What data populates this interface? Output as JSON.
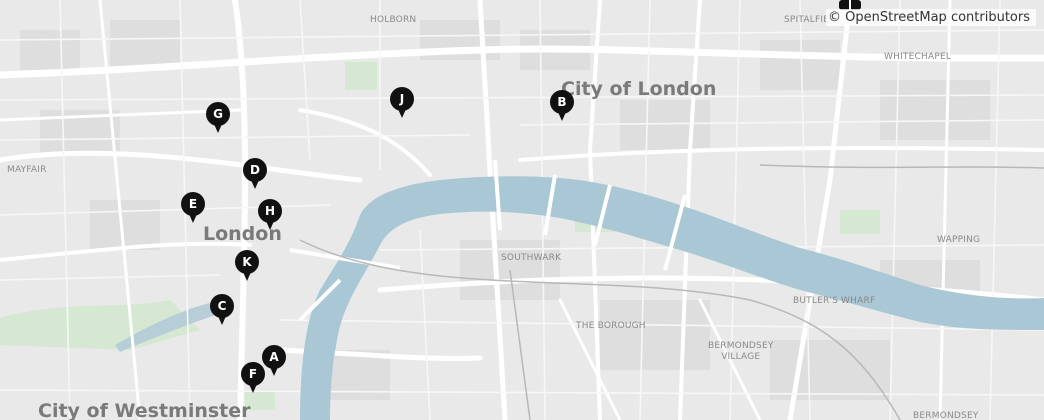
{
  "attribution": "© OpenStreetMap contributors",
  "place_labels": {
    "city_of_london": "City of London",
    "london": "London",
    "city_of_westminster": "City of Westminster",
    "holborn": "HOLBORN",
    "spitalfields": "SPITALFIE",
    "whitechapel": "WHITECHAPEL",
    "mayfair": "MAYFAIR",
    "southwark": "SOUTHWARK",
    "wapping": "WAPPING",
    "butlers_wharf": "BUTLER'S WHARF",
    "the_borough": "THE BOROUGH",
    "bermondsey_village": "BERMONDSEY\nVILLAGE",
    "bermondsey": "BERMONDSEY"
  },
  "markers": [
    {
      "id": "A",
      "label": "A"
    },
    {
      "id": "B",
      "label": "B"
    },
    {
      "id": "C",
      "label": "C"
    },
    {
      "id": "D",
      "label": "D"
    },
    {
      "id": "E",
      "label": "E"
    },
    {
      "id": "F",
      "label": "F"
    },
    {
      "id": "G",
      "label": "G"
    },
    {
      "id": "H",
      "label": "H"
    },
    {
      "id": "J",
      "label": "J"
    },
    {
      "id": "K",
      "label": "K"
    }
  ],
  "colors": {
    "land": "#e9e9e9",
    "river": "#a9c7d4",
    "park": "#d5e8d2",
    "road": "#ffffff",
    "marker": "#111111"
  }
}
